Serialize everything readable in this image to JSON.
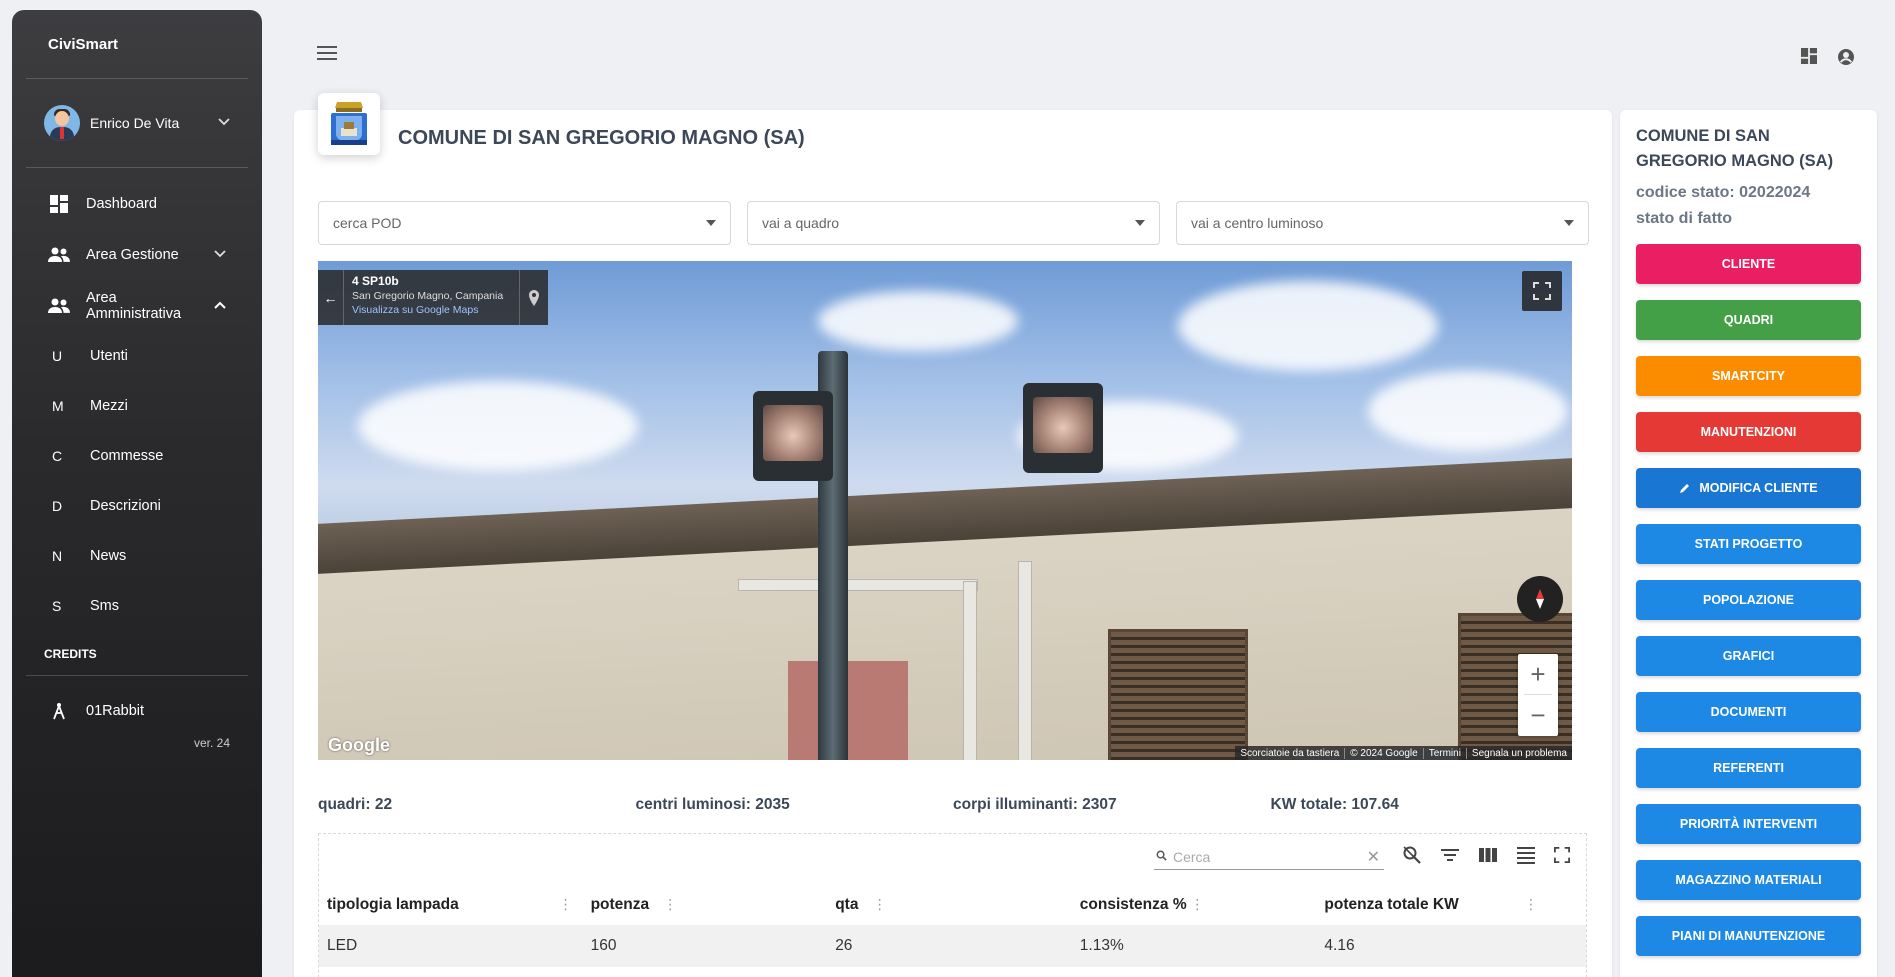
{
  "app": {
    "name": "CiviSmart",
    "version": "ver. 24"
  },
  "user": {
    "name": "Enrico De Vita"
  },
  "sidebar": {
    "items": [
      {
        "label": "Dashboard"
      },
      {
        "label": "Area Gestione"
      },
      {
        "label": "Area Amministrativa"
      }
    ],
    "admin_subitems": [
      {
        "letter": "U",
        "label": "Utenti"
      },
      {
        "letter": "M",
        "label": "Mezzi"
      },
      {
        "letter": "C",
        "label": "Commesse"
      },
      {
        "letter": "D",
        "label": "Descrizioni"
      },
      {
        "letter": "N",
        "label": "News"
      },
      {
        "letter": "S",
        "label": "Sms"
      }
    ],
    "credits_heading": "CREDITS",
    "credits_item": "01Rabbit"
  },
  "main": {
    "title": "COMUNE DI SAN GREGORIO MAGNO (SA)",
    "selects": [
      {
        "placeholder": "cerca POD"
      },
      {
        "placeholder": "vai a quadro"
      },
      {
        "placeholder": "vai a centro luminoso"
      }
    ],
    "streetview": {
      "title": "4 SP10b",
      "location": "San Gregorio Magno, Campania",
      "link": "Visualizza su Google Maps",
      "google_logo": "Google",
      "footer": [
        "Scorciatoie da tastiera",
        "© 2024 Google",
        "Termini",
        "Segnala un problema"
      ]
    },
    "stats": {
      "quadri": "quadri: 22",
      "centri": "centri luminosi: 2035",
      "corpi": "corpi illuminanti: 2307",
      "kw": "KW totale: 107.64"
    },
    "table": {
      "search_placeholder": "Cerca",
      "columns": [
        "tipologia lampada",
        "potenza",
        "qta",
        "consistenza %",
        "potenza totale KW"
      ],
      "rows": [
        [
          "LED",
          "160",
          "26",
          "1.13%",
          "4.16"
        ]
      ]
    }
  },
  "right_panel": {
    "title": "COMUNE DI SAN GREGORIO MAGNO (SA)",
    "code": "codice stato: 02022024",
    "state": "stato di fatto",
    "buttons": [
      {
        "label": "CLIENTE",
        "color": "#e91e63"
      },
      {
        "label": "QUADRI",
        "color": "#43a047"
      },
      {
        "label": "SMARTCITY",
        "color": "#fb8c00"
      },
      {
        "label": "MANUTENZIONI",
        "color": "#e53935"
      },
      {
        "label": "MODIFICA CLIENTE",
        "color": "#1976d2",
        "icon": "pencil-icon"
      },
      {
        "label": "STATI PROGETTO",
        "color": "#1e88e5"
      },
      {
        "label": "POPOLAZIONE",
        "color": "#1e88e5"
      },
      {
        "label": "GRAFICI",
        "color": "#1e88e5"
      },
      {
        "label": "DOCUMENTI",
        "color": "#1e88e5"
      },
      {
        "label": "REFERENTI",
        "color": "#1e88e5"
      },
      {
        "label": "PRIORITÀ INTERVENTI",
        "color": "#1e88e5"
      },
      {
        "label": "MAGAZZINO MATERIALI",
        "color": "#1e88e5"
      },
      {
        "label": "PIANI DI MANUTENZIONE",
        "color": "#1e88e5"
      }
    ]
  }
}
